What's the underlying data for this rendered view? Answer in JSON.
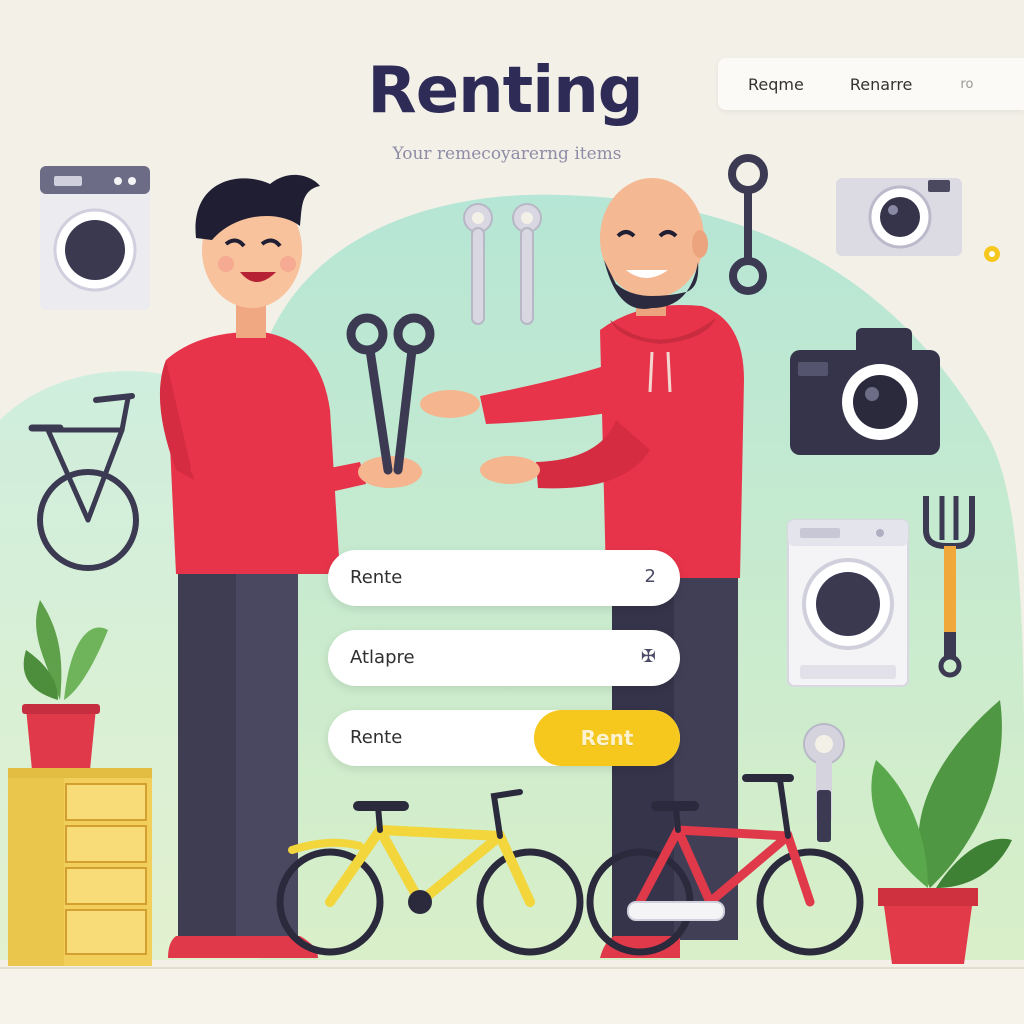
{
  "header": {
    "title": "Renting",
    "subtitle": "Your remecoyarerng items"
  },
  "nav": {
    "items": [
      {
        "label": "Reqme"
      },
      {
        "label": "Renarre"
      },
      {
        "label": "ro"
      }
    ]
  },
  "form": {
    "field1": {
      "value": "Rente",
      "suffix": "2"
    },
    "field2": {
      "value": "Atlapre",
      "suffix": "✠"
    },
    "field3": {
      "value": "Rente",
      "button_label": "Rent"
    }
  },
  "colors": {
    "accent": "#f6c81e",
    "shirt": "#e8344a",
    "blob": "#b8e8d3",
    "title": "#2e2c57"
  },
  "icons": [
    "washing-machine-icon",
    "camera-icon",
    "bicycle-icon",
    "wrench-icon",
    "potted-plant-icon",
    "drawer-cabinet-icon",
    "rake-icon"
  ]
}
